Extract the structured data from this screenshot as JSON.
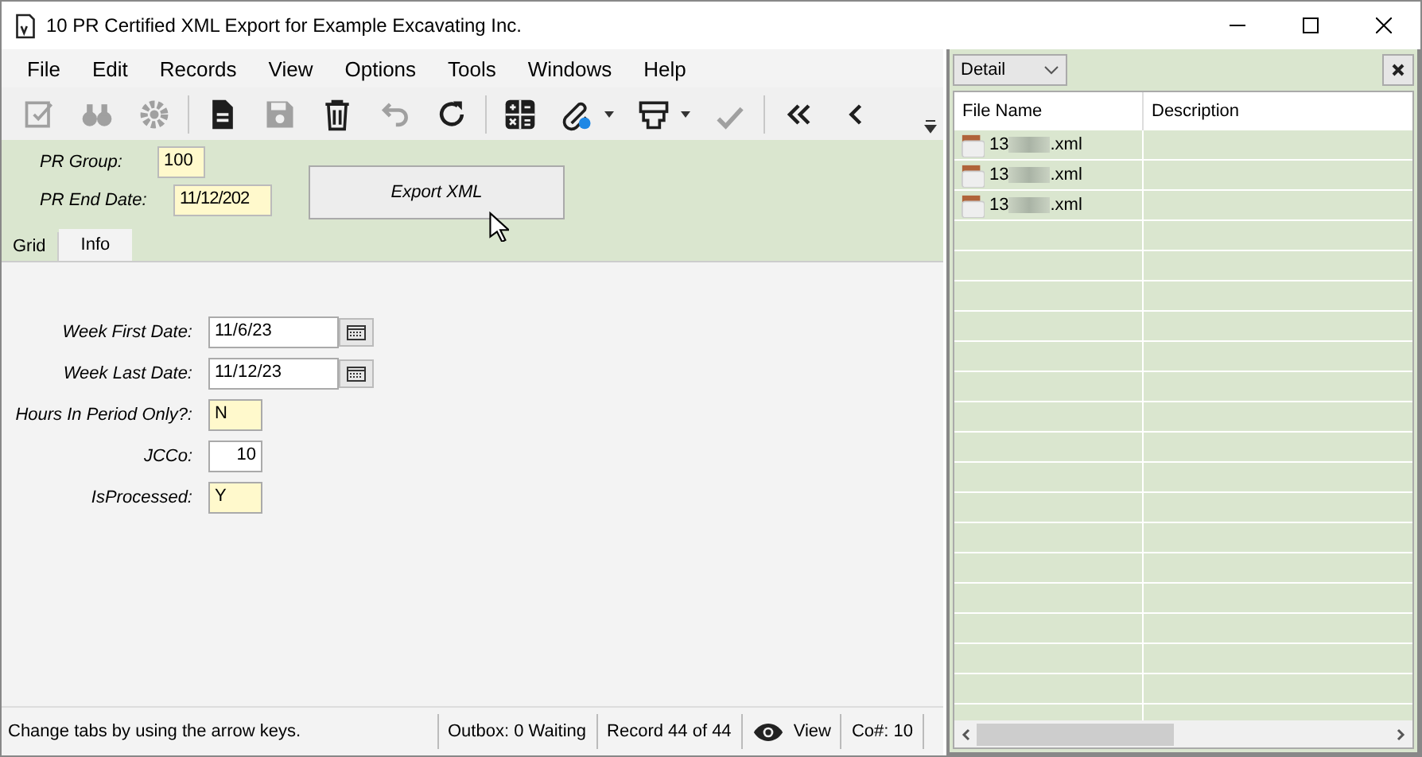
{
  "window": {
    "title": "10 PR Certified XML Export for Example Excavating Inc."
  },
  "menu": [
    "File",
    "Edit",
    "Records",
    "View",
    "Options",
    "Tools",
    "Windows",
    "Help"
  ],
  "toolbar": [
    {
      "kind": "edit",
      "disabled": true
    },
    {
      "kind": "binoculars",
      "disabled": true
    },
    {
      "kind": "gear",
      "disabled": true
    },
    {
      "kind": "sep"
    },
    {
      "kind": "document",
      "disabled": false
    },
    {
      "kind": "save",
      "disabled": true
    },
    {
      "kind": "trash",
      "disabled": false
    },
    {
      "kind": "undo",
      "disabled": true
    },
    {
      "kind": "refresh",
      "disabled": false
    },
    {
      "kind": "sep"
    },
    {
      "kind": "calculator",
      "disabled": false
    },
    {
      "kind": "attach",
      "disabled": false,
      "dropdown": true
    },
    {
      "kind": "print",
      "disabled": false,
      "dropdown": true
    },
    {
      "kind": "spell",
      "disabled": true
    },
    {
      "kind": "sep"
    },
    {
      "kind": "first",
      "disabled": false
    },
    {
      "kind": "prev",
      "disabled": false
    }
  ],
  "header": {
    "fields": [
      {
        "label": "PR Group:",
        "value": "100",
        "highlighted": true
      },
      {
        "label": "PR End Date:",
        "value": "11/12/202",
        "highlighted": true
      }
    ],
    "button": "Export XML"
  },
  "tabs": [
    {
      "label": "Grid",
      "selected": false
    },
    {
      "label": "Info",
      "selected": true
    }
  ],
  "info_fields": [
    {
      "label": "Week First Date:",
      "value": "11/6/23",
      "highlighted": false,
      "kind": "date"
    },
    {
      "label": "Week Last Date:",
      "value": "11/12/23",
      "highlighted": false,
      "kind": "date"
    },
    {
      "label": "Hours In Period Only?:",
      "value": "N",
      "highlighted": true,
      "kind": "text"
    },
    {
      "label": "JCCo:",
      "value": "10",
      "highlighted": false,
      "kind": "number"
    },
    {
      "label": "IsProcessed:",
      "value": "Y",
      "highlighted": true,
      "kind": "text"
    }
  ],
  "status_bar": {
    "message": "Change tabs by using the arrow keys.",
    "outbox": "Outbox: 0 Waiting",
    "record": "Record 44 of 44",
    "mode": "View",
    "company": "Co#: 10"
  },
  "side_panel": {
    "view": "Detail",
    "columns": [
      "File Name",
      "Description"
    ],
    "files": [
      {
        "prefix": "13",
        "suffix": ".xml"
      },
      {
        "prefix": "13",
        "suffix": ".xml"
      },
      {
        "prefix": "13",
        "suffix": ".xml"
      }
    ]
  }
}
